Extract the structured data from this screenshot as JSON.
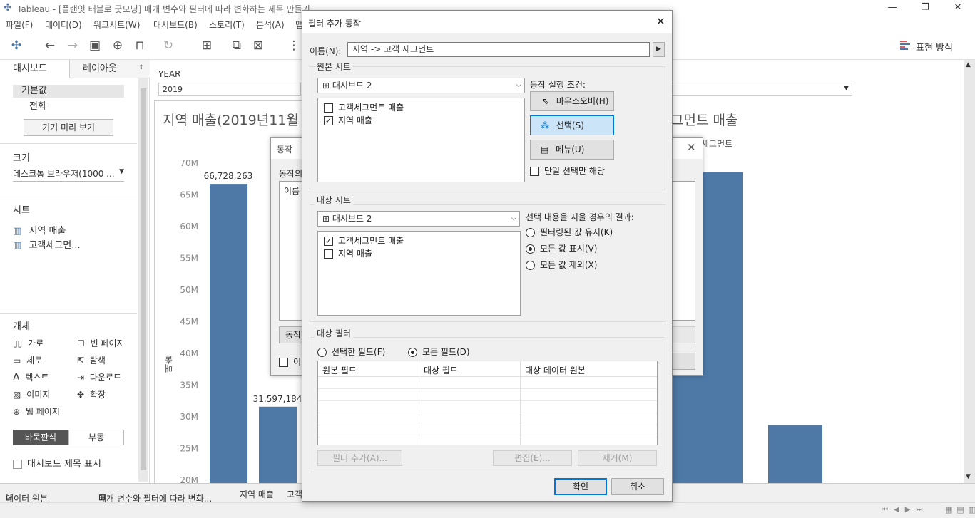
{
  "app": {
    "title": "Tableau - [플랜잇 태블로 굿모닝] 매개 변수와 필터에 따라 변화하는 제목 만들기",
    "menu": [
      "파일(F)",
      "데이터(D)",
      "워크시트(W)",
      "대시보드(B)",
      "스토리(T)",
      "분석(A)",
      "맵"
    ],
    "show_me": "표현 방식"
  },
  "left_panel": {
    "tabs": [
      "대시보드",
      "레이아웃"
    ],
    "device": {
      "default": "기본값",
      "phone": "전화",
      "preview_button": "기기 미리 보기"
    },
    "size": {
      "title": "크기",
      "value": "데스크톱 브라우저(1000 ..."
    },
    "sheets": {
      "title": "시트",
      "items": [
        "지역 매출",
        "고객세그먼..."
      ]
    },
    "objects": {
      "title": "개체",
      "items": [
        "가로",
        "빈 페이지",
        "세로",
        "탐색",
        "텍스트",
        "다운로드",
        "이미지",
        "확장",
        "웹 페이지"
      ],
      "tiled": "바둑판식",
      "floating": "부동",
      "show_title": "대시보드 제목 표시"
    }
  },
  "canvas": {
    "param_label": "YEAR",
    "param_value": "2019",
    "chart_title_left": "지역 매출(2019년11월",
    "chart_title_right": "그먼트 매출",
    "legend_fragment": "세그먼트",
    "yaxis_label": "매출"
  },
  "chart_data": {
    "type": "bar",
    "title": "지역 매출(2019년11월",
    "ylabel": "매출",
    "ylim": [
      20000000,
      70000000
    ],
    "yticks": [
      "70M",
      "65M",
      "60M",
      "55M",
      "50M",
      "45M",
      "40M",
      "35M",
      "30M",
      "25M",
      "20M"
    ],
    "values": [
      66728263,
      31597184
    ],
    "value_labels": [
      "66,728,263",
      "31,597,184"
    ],
    "right_values": [
      68600000,
      28700000
    ]
  },
  "behind_dialog": {
    "title": "동작",
    "label": "동작의",
    "col": "이름",
    "btn_left": "동작",
    "chk": "이"
  },
  "dialog": {
    "title": "필터 추가 동작",
    "name_label": "이름(N):",
    "name_value": "지역 -> 고객 세그먼트",
    "source": {
      "label": "원본 시트",
      "combo": "대시보드 2",
      "items": [
        {
          "label": "고객세그먼트 매출",
          "checked": false
        },
        {
          "label": "지역 매출",
          "checked": true
        }
      ],
      "run_label": "동작 실행 조건:",
      "hover": "마우스오버(H)",
      "select": "선택(S)",
      "menu": "메뉴(U)",
      "single": "단일 선택만 해당"
    },
    "target": {
      "label": "대상 시트",
      "combo": "대시보드 2",
      "items": [
        {
          "label": "고객세그먼트 매출",
          "checked": true
        },
        {
          "label": "지역 매출",
          "checked": false
        }
      ],
      "clear_label": "선택 내용을 지울 경우의 결과:",
      "keep": "필터링된 값 유지(K)",
      "show_all": "모든 값 표시(V)",
      "exclude": "모든 값 제외(X)"
    },
    "filters": {
      "label": "대상 필터",
      "selected": "선택한 필드(F)",
      "all": "모든 필드(D)",
      "columns": [
        "원본 필드",
        "대상 필드",
        "대상 데이터 원본"
      ],
      "add": "필터 추가(A)...",
      "edit": "편집(E)...",
      "remove": "제거(M)"
    },
    "ok": "확인",
    "cancel": "취소"
  },
  "bottom": {
    "datasource": "데이터 원본",
    "tabs": [
      "매개 변수와 필터에 따라 변화...",
      "지역 매출",
      "고객"
    ]
  }
}
